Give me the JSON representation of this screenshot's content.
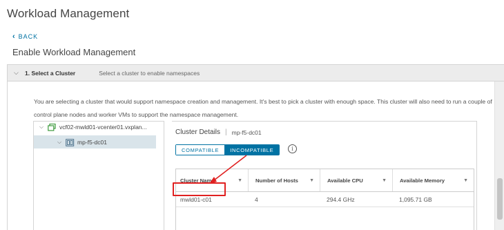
{
  "page": {
    "title": "Workload Management",
    "back_label": "BACK",
    "section_title": "Enable Workload Management"
  },
  "step": {
    "label": "1. Select a Cluster",
    "description": "Select a cluster to enable namespaces",
    "expanded": true
  },
  "info_text": "You are selecting a cluster that would support namespace creation and management. It's best to pick a cluster with enough space. This cluster will also need to run a couple of control plane nodes and worker VMs to support the namespace management.",
  "tree": {
    "items": [
      {
        "label": "vcf02-mwld01-vcenter01.vxplan...",
        "icon": "datacenter-icon",
        "expanded": true
      },
      {
        "label": "mp-f5-dc01",
        "icon": "cluster-icon",
        "expanded": true,
        "selected": true
      }
    ]
  },
  "details": {
    "title": "Cluster Details",
    "cluster_name": "mp-f5-dc01",
    "tabs": [
      {
        "label": "COMPATIBLE",
        "active": false
      },
      {
        "label": "INCOMPATIBLE",
        "active": true
      }
    ],
    "info_icon_glyph": "i"
  },
  "table": {
    "columns": [
      "Cluster Name",
      "Number of Hosts",
      "Available CPU",
      "Available Memory"
    ],
    "rows": [
      {
        "cluster_name": "mwld01-c01",
        "hosts": "4",
        "cpu": "294.4 GHz",
        "memory": "1,095.71 GB"
      }
    ]
  },
  "colors": {
    "accent": "#0072a3",
    "annotation": "#e02020",
    "tree_icon": "#3c9a3c",
    "header_bg": "#ececec",
    "selected_bg": "#d9e4ea"
  }
}
